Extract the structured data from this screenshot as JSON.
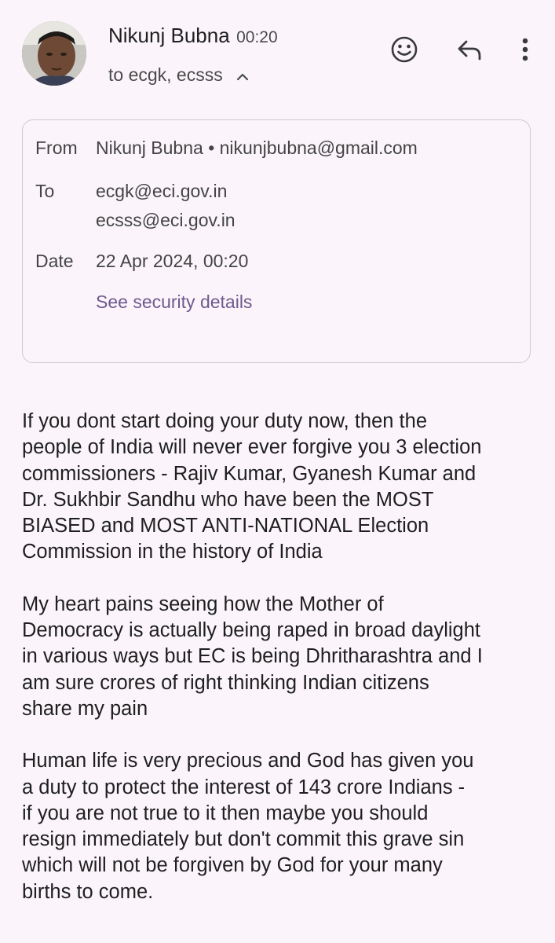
{
  "header": {
    "sender_name": "Nikunj Bubna",
    "time": "00:20",
    "recipients": "to ecgk, ecsss",
    "icons": [
      "emoji-icon",
      "reply-icon",
      "more-vert-icon",
      "chevron-up-icon"
    ]
  },
  "details": {
    "from_label": "From",
    "from_value": "Nikunj Bubna • nikunjbubna@gmail.com",
    "to_label": "To",
    "to_values": [
      "ecgk@eci.gov.in",
      "ecsss@eci.gov.in"
    ],
    "date_label": "Date",
    "date_value": "22 Apr 2024, 00:20",
    "security_link": "See security details"
  },
  "body": {
    "paragraphs": [
      [
        "If you dont start doing your duty now, then the",
        "people of India will never ever forgive you 3 election",
        "commissioners - Rajiv Kumar, Gyanesh Kumar and",
        "Dr. Sukhbir Sandhu who have been the MOST",
        "BIASED and MOST ANTI-NATIONAL Election",
        "Commission in the history of India"
      ],
      [
        "My heart pains seeing how the Mother of",
        "Democracy is actually being raped in broad daylight",
        "in various ways but EC is being Dhritharashtra and I",
        "am sure crores of right thinking Indian citizens",
        "share my pain"
      ],
      [
        "Human life is very precious and God has given you",
        "a duty to protect the interest of 143 crore Indians -",
        "if you are not true to it then maybe you should",
        "resign immediately but don't commit this grave sin",
        "which will not be forgiven by God for your many",
        "births to come."
      ]
    ]
  },
  "colors": {
    "background": "#fbf5fb",
    "link": "#6e5a8f",
    "card_border": "#cfc8d0"
  }
}
